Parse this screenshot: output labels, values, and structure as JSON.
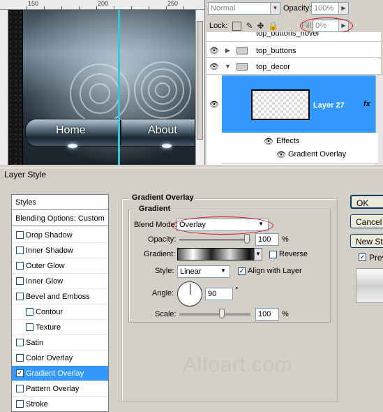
{
  "ruler": {
    "marks": [
      "150",
      "200",
      "250"
    ]
  },
  "canvas": {
    "nav_items": [
      "Home",
      "About"
    ]
  },
  "layers_panel": {
    "blend_mode": "Normal",
    "opacity_label": "Opacity:",
    "opacity_value": "100%",
    "lock_label": "Lock:",
    "fill_label": "Fill:",
    "fill_value": "0%",
    "layers": [
      {
        "name": "top_buttons_hover"
      },
      {
        "name": "top_buttons"
      },
      {
        "name": "top_decor"
      },
      {
        "name": "Layer 27"
      }
    ],
    "effects_label": "Effects",
    "effect_item": "Gradient Overlay",
    "fx_label": "fx"
  },
  "dialog": {
    "title": "Layer Style",
    "styles_header": "Styles",
    "blending_options": "Blending Options: Custom",
    "style_items": [
      {
        "label": "Drop Shadow",
        "checked": false
      },
      {
        "label": "Inner Shadow",
        "checked": false
      },
      {
        "label": "Outer Glow",
        "checked": false
      },
      {
        "label": "Inner Glow",
        "checked": false
      },
      {
        "label": "Bevel and Emboss",
        "checked": false
      },
      {
        "label": "Contour",
        "checked": false
      },
      {
        "label": "Texture",
        "checked": false
      },
      {
        "label": "Satin",
        "checked": false
      },
      {
        "label": "Color Overlay",
        "checked": false
      },
      {
        "label": "Gradient Overlay",
        "checked": true
      },
      {
        "label": "Pattern Overlay",
        "checked": false
      },
      {
        "label": "Stroke",
        "checked": false
      }
    ],
    "section_title": "Gradient Overlay",
    "group_title": "Gradient",
    "blend_mode_label": "Blend Mode:",
    "blend_mode_value": "Overlay",
    "opacity_label": "Opacity:",
    "opacity_value": "100",
    "gradient_label": "Gradient:",
    "reverse_label": "Reverse",
    "style_label": "Style:",
    "style_value": "Linear",
    "align_label": "Align with Layer",
    "angle_label": "Angle:",
    "angle_value": "90",
    "degree_symbol": "°",
    "scale_label": "Scale:",
    "scale_value": "100",
    "percent": "%",
    "buttons": {
      "ok": "OK",
      "cancel": "Cancel",
      "new_style": "New Style...",
      "preview": "Preview"
    }
  },
  "watermark": "Alfoart.com",
  "colors": {
    "selection": "#3399ff",
    "guide": "#35c6d6",
    "highlight_circle": "#d01020"
  }
}
